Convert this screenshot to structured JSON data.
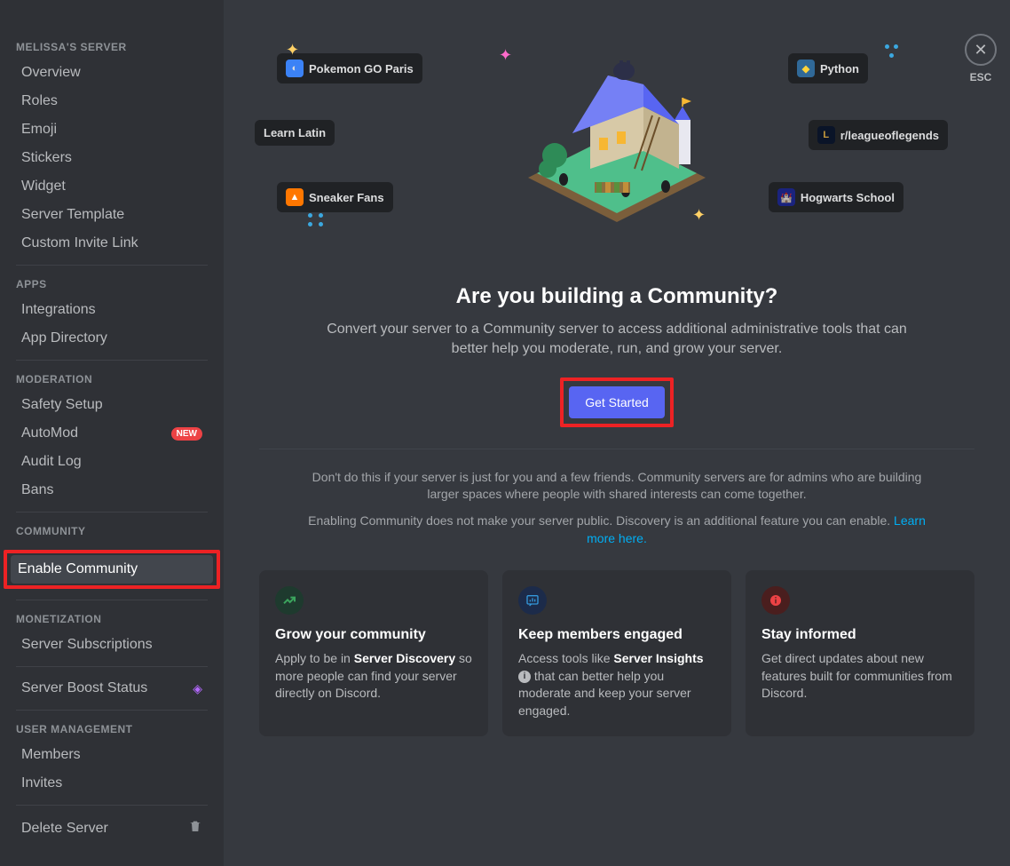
{
  "sidebar": {
    "server_header": "MELISSA'S SERVER",
    "items_server": [
      {
        "label": "Overview"
      },
      {
        "label": "Roles"
      },
      {
        "label": "Emoji"
      },
      {
        "label": "Stickers"
      },
      {
        "label": "Widget"
      },
      {
        "label": "Server Template"
      },
      {
        "label": "Custom Invite Link"
      }
    ],
    "apps_header": "APPS",
    "items_apps": [
      {
        "label": "Integrations"
      },
      {
        "label": "App Directory"
      }
    ],
    "moderation_header": "MODERATION",
    "items_moderation": [
      {
        "label": "Safety Setup"
      },
      {
        "label": "AutoMod",
        "badge": "NEW"
      },
      {
        "label": "Audit Log"
      },
      {
        "label": "Bans"
      }
    ],
    "community_header": "COMMUNITY",
    "items_community": [
      {
        "label": "Enable Community",
        "active": true
      }
    ],
    "monetization_header": "MONETIZATION",
    "items_monetization": [
      {
        "label": "Server Subscriptions"
      }
    ],
    "boost_label": "Server Boost Status",
    "user_mgmt_header": "USER MANAGEMENT",
    "items_user_mgmt": [
      {
        "label": "Members"
      },
      {
        "label": "Invites"
      }
    ],
    "delete_label": "Delete Server"
  },
  "hero_chips": {
    "pokemon": "Pokemon GO Paris",
    "python": "Python",
    "latin": "Learn Latin",
    "league": "r/leagueoflegends",
    "sneaker": "Sneaker Fans",
    "hogwarts": "Hogwarts School"
  },
  "main": {
    "headline": "Are you building a Community?",
    "subhead": "Convert your server to a Community server to access additional administrative tools that can better help you moderate, run, and grow your server.",
    "cta": "Get Started",
    "fineprint1": "Don't do this if your server is just for you and a few friends. Community servers are for admins who are building larger spaces where people with shared interests can come together.",
    "fineprint2_a": "Enabling Community does not make your server public. Discovery is an additional feature you can enable. ",
    "fineprint2_link": "Learn more here."
  },
  "cards": [
    {
      "title": "Grow your community",
      "body_pre": "Apply to be in ",
      "body_strong": "Server Discovery",
      "body_post": " so more people can find your server directly on Discord.",
      "icon_bg": "#1e3a2e",
      "icon_color": "#3ba55d"
    },
    {
      "title": "Keep members engaged",
      "body_pre": "Access tools like ",
      "body_strong": "Server Insights",
      "body_post": " that can better help you moderate and keep your server engaged.",
      "icon_bg": "#1c2b4a",
      "icon_color": "#3498db",
      "has_info_badge": true
    },
    {
      "title": "Stay informed",
      "body_pre": "Get direct updates about new features built for communities from Discord.",
      "body_strong": "",
      "body_post": "",
      "icon_bg": "#4a1e1e",
      "icon_color": "#ed4245"
    }
  ],
  "esc": {
    "label": "ESC"
  }
}
